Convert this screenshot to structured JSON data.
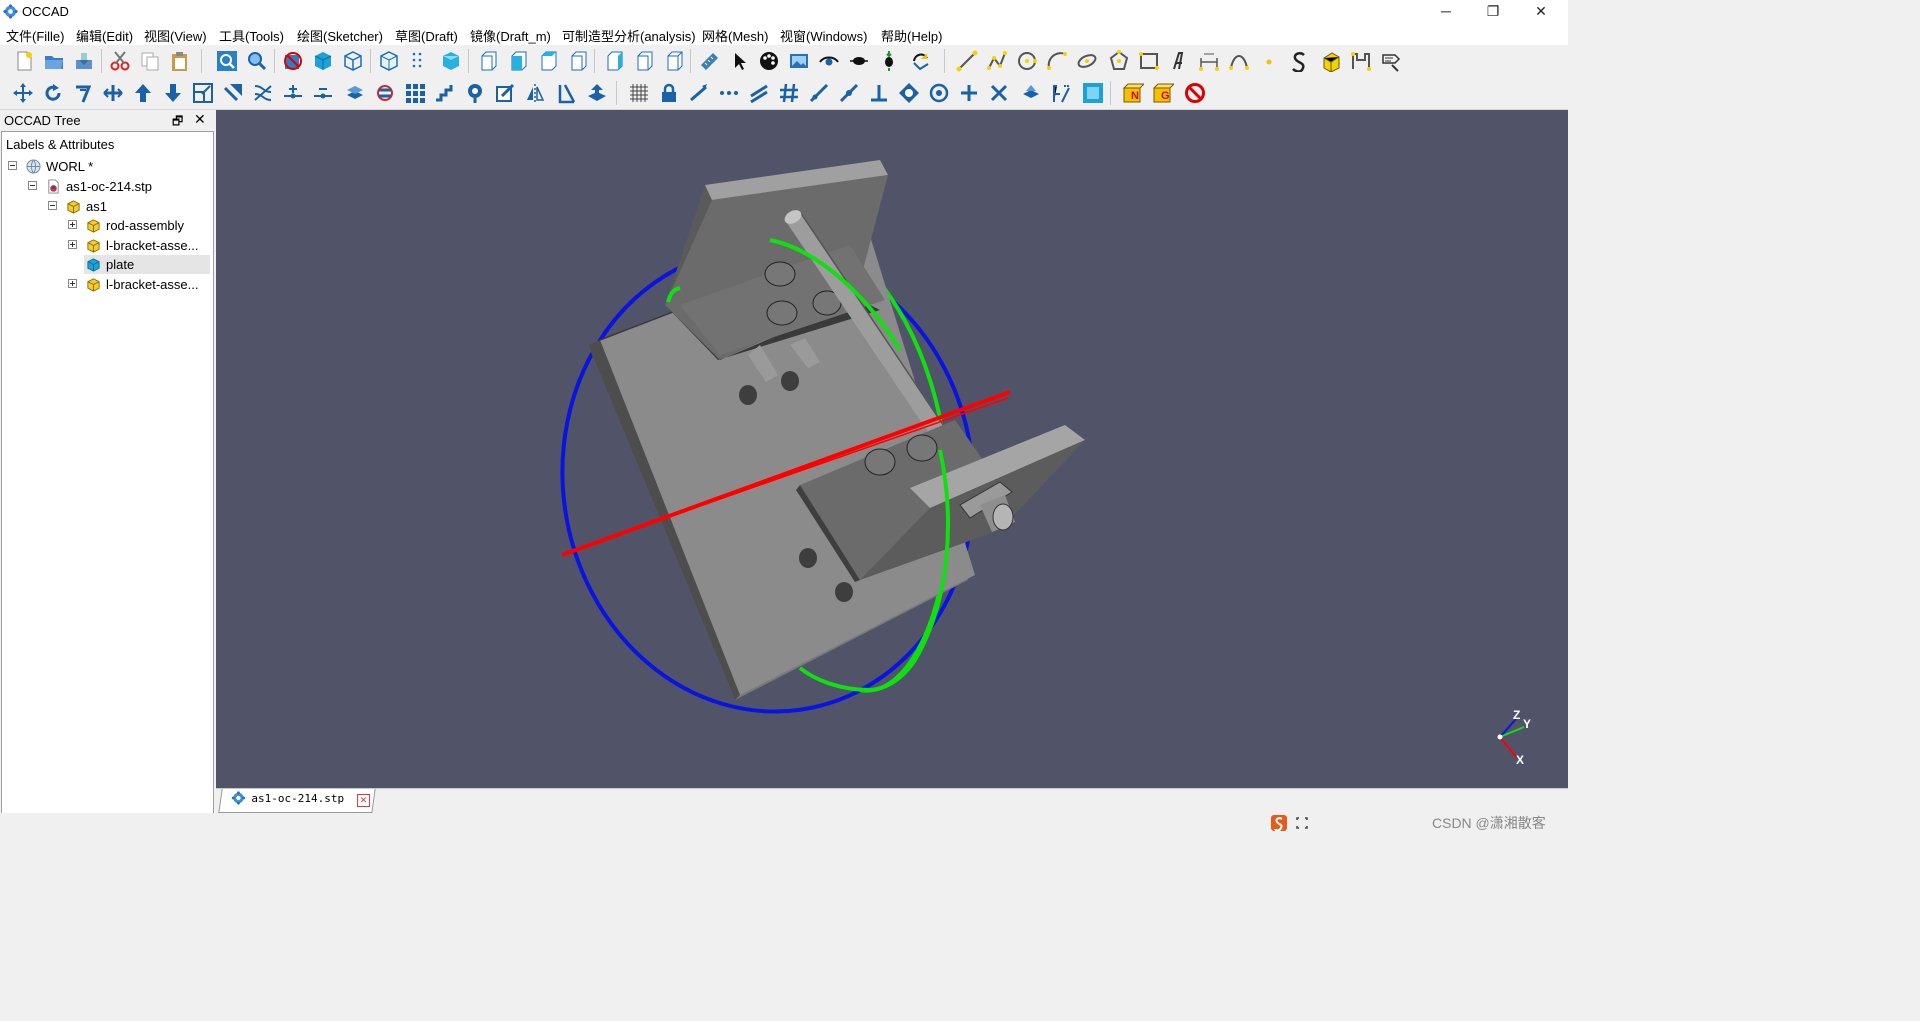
{
  "window": {
    "title": "OCCAD",
    "minimize": "─",
    "maximize": "❐",
    "close": "✕"
  },
  "menu": [
    "文件(Fille)",
    "编辑(Edit)",
    "视图(View)",
    "工具(Tools)",
    "绘图(Sketcher)",
    "草图(Draft)",
    "镜像(Draft_m)",
    "可制造型分析(analysis)",
    "网格(Mesh)",
    "视窗(Windows)",
    "帮助(Help)"
  ],
  "dock": {
    "title": "OCCAD Tree",
    "float_glyph": "🗗",
    "close_glyph": "✕",
    "tree_header": "Labels & Attributes",
    "nodes": [
      {
        "label": "WORL *",
        "icon": "world-icon"
      },
      {
        "label": "as1-oc-214.stp",
        "icon": "step-file-icon"
      },
      {
        "label": "as1",
        "icon": "assembly-icon"
      },
      {
        "label": "rod-assembly",
        "icon": "assembly-icon"
      },
      {
        "label": "l-bracket-asse...",
        "icon": "assembly-icon"
      },
      {
        "label": "plate",
        "icon": "part-icon",
        "selected": true
      },
      {
        "label": "l-bracket-asse...",
        "icon": "assembly-icon"
      }
    ]
  },
  "viewport": {
    "background": "#515369",
    "axis_colors": {
      "x": "#ff0000",
      "y": "#00dd00",
      "z": "#0000ee"
    },
    "triad_labels": {
      "z": "Z",
      "y": "Y",
      "x": "X"
    }
  },
  "tabs": [
    {
      "label": "as1-oc-214.stp",
      "close": "✕"
    }
  ],
  "status": {
    "watermark": "CSDN @潇湘散客"
  }
}
